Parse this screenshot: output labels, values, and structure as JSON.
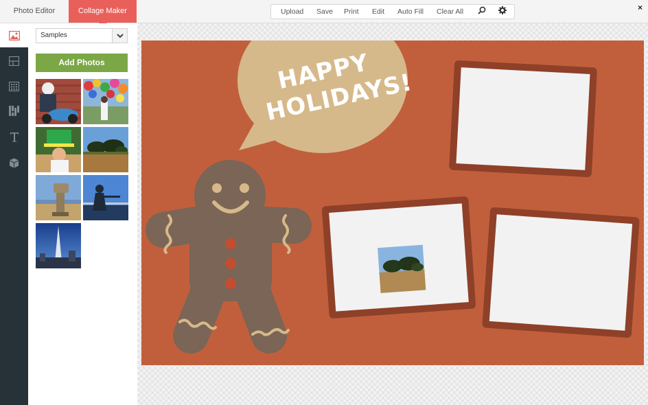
{
  "tabs": {
    "photo_editor": "Photo Editor",
    "collage_maker": "Collage Maker"
  },
  "menu": {
    "upload": "Upload",
    "save": "Save",
    "print": "Print",
    "edit": "Edit",
    "auto_fill": "Auto Fill",
    "clear_all": "Clear All"
  },
  "close_label": "×",
  "sidebar": {
    "select_value": "Samples",
    "add_photos": "Add Photos"
  },
  "collage": {
    "line1": "HAPPY",
    "line2": "HOLIDAYS!"
  },
  "colors": {
    "accent": "#e9605b",
    "add_button": "#7ba747",
    "rail": "#263238",
    "collage_bg": "#c15f3c",
    "frame": "#8f4028",
    "bubble": "#d6b98a",
    "gingerbread": "#7a6556"
  },
  "icons": [
    "image-icon",
    "layout-icon",
    "grid-icon",
    "pattern-icon",
    "text-icon",
    "cube-icon",
    "search-icon",
    "gear-icon",
    "chevron-down-icon",
    "close-icon"
  ]
}
